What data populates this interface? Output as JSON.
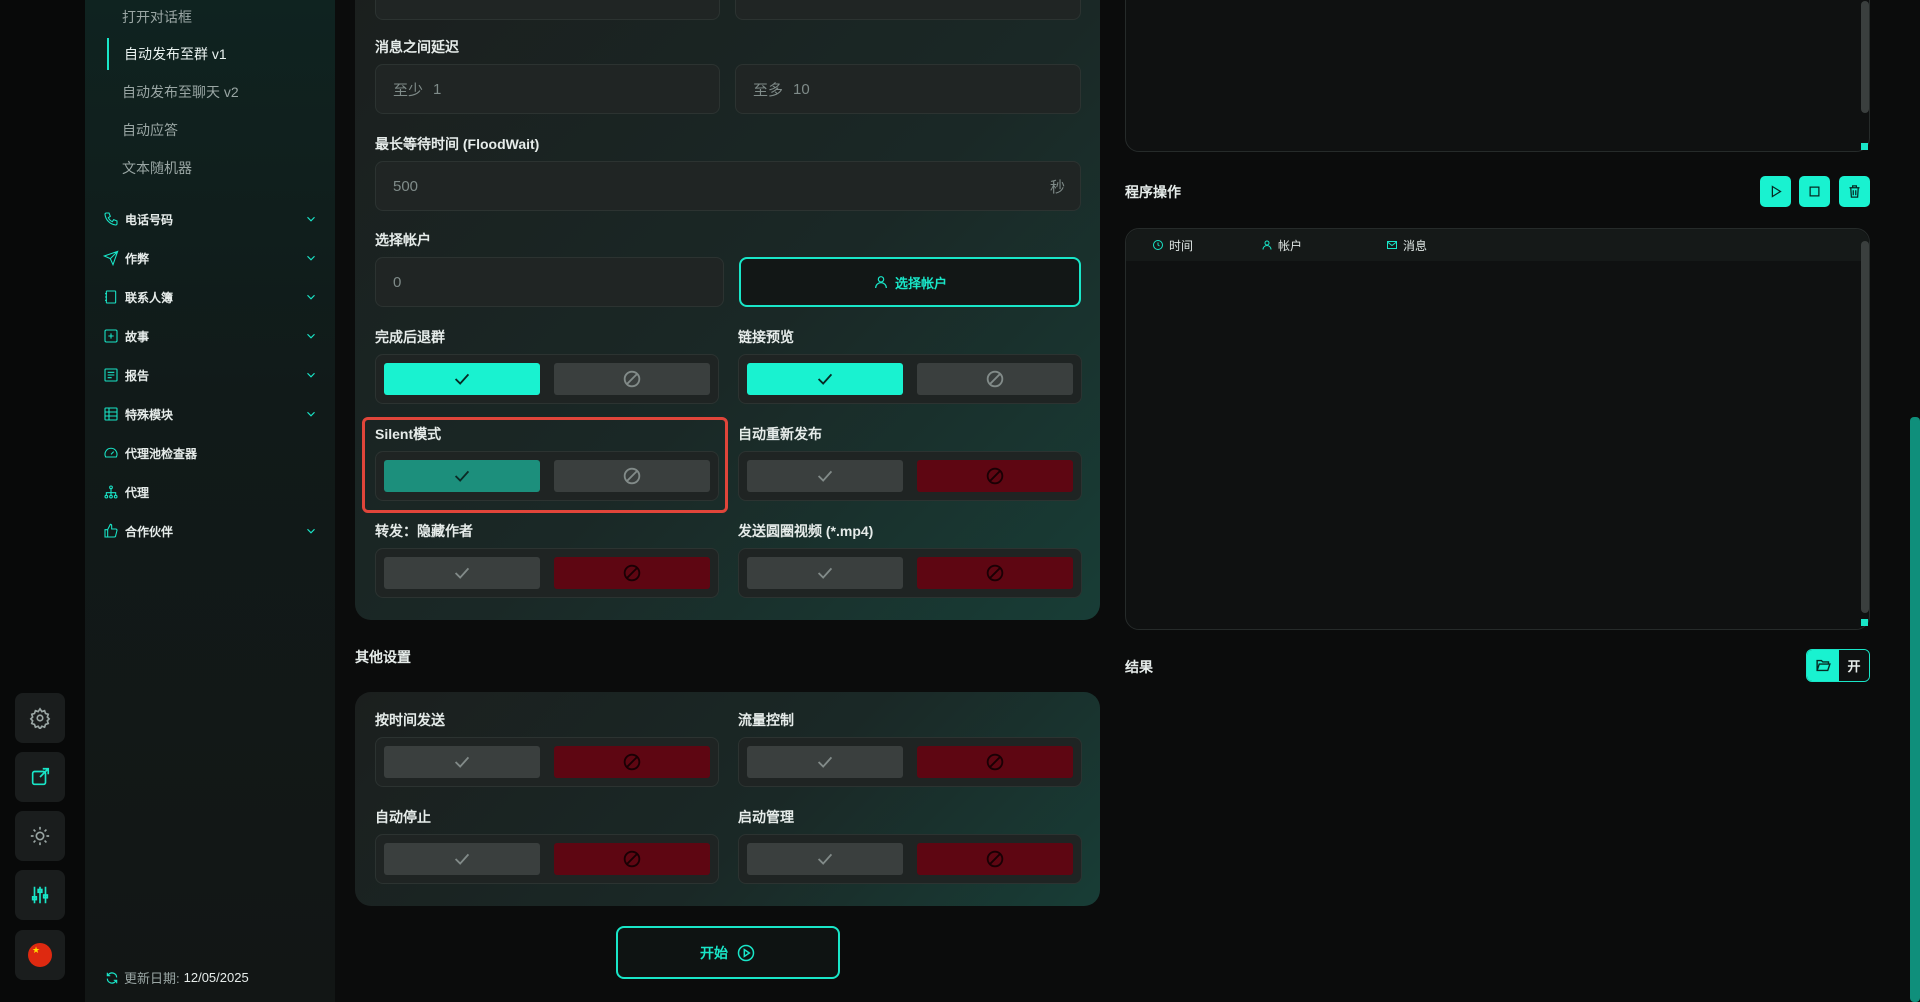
{
  "sidebar": {
    "sub_items": [
      "打开对话框",
      "自动发布至群 v1",
      "自动发布至聊天 v2",
      "自动应答",
      "文本随机器"
    ],
    "nav_items": [
      {
        "label": "电话号码",
        "icon": "phone-icon",
        "expandable": true
      },
      {
        "label": "作弊",
        "icon": "send-icon",
        "expandable": true
      },
      {
        "label": "联系人簿",
        "icon": "contacts-icon",
        "expandable": true
      },
      {
        "label": "故事",
        "icon": "plus-square-icon",
        "expandable": true
      },
      {
        "label": "报告",
        "icon": "report-icon",
        "expandable": true
      },
      {
        "label": "特殊模块",
        "icon": "modules-icon",
        "expandable": true
      },
      {
        "label": "代理池检查器",
        "icon": "gauge-icon",
        "expandable": false
      },
      {
        "label": "代理",
        "icon": "network-icon",
        "expandable": false
      },
      {
        "label": "合作伙伴",
        "icon": "thumbs-up-icon",
        "expandable": true
      }
    ],
    "update_label": "更新日期:",
    "update_date": "12/05/2025"
  },
  "form": {
    "delay_label": "消息之间延迟",
    "delay_min": {
      "prefix": "至少",
      "value": "1"
    },
    "delay_max": {
      "prefix": "至多",
      "value": "10"
    },
    "floodwait_label": "最长等待时间 (FloodWait)",
    "floodwait_value": "500",
    "floodwait_unit": "秒",
    "account_label": "选择帐户",
    "account_value": "0",
    "select_account_button": "选择帐户",
    "leave_group_label": "完成后退群",
    "link_preview_label": "链接预览",
    "silent_label": "Silent模式",
    "auto_repost_label": "自动重新发布",
    "forward_hide_label": "转发：隐藏作者",
    "round_video_label": "发送圆圈视频 (*.mp4)"
  },
  "other": {
    "title": "其他设置",
    "schedule_label": "按时间发送",
    "traffic_label": "流量控制",
    "auto_stop_label": "自动停止",
    "startup_label": "启动管理"
  },
  "start_button": "开始",
  "right": {
    "ops_title": "程序操作",
    "columns": [
      "时间",
      "帐户",
      "消息"
    ],
    "results_title": "结果",
    "results_toggle": "开"
  },
  "colors": {
    "accent": "#19f2d0",
    "danger": "#5e0612",
    "highlight": "#e0453a"
  }
}
